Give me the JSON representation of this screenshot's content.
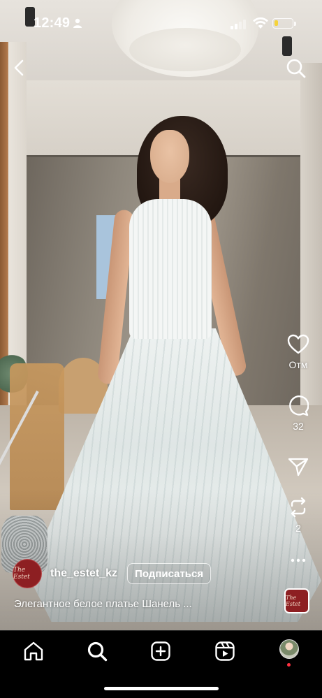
{
  "status_bar": {
    "time": "12:49",
    "battery_level": 0.2,
    "battery_color": "#f5d33a"
  },
  "top_bar": {
    "back_icon": "chevron-left-icon",
    "search_icon": "search-icon"
  },
  "right_rail": {
    "like_count": "Отм",
    "comment_count": "32",
    "repost_count": "2"
  },
  "post": {
    "author_avatar_text": "The Estet",
    "username": "the_estet_kz",
    "follow_label": "Подписаться",
    "caption": "Элегантное белое платье Шанель ...",
    "audio_thumb_text": "The Estet"
  },
  "bottom_nav": {
    "items": [
      "home-icon",
      "search-icon",
      "create-icon",
      "reels-icon",
      "profile-avatar"
    ],
    "active": "reels-icon",
    "notification_color": "#ff3040"
  }
}
